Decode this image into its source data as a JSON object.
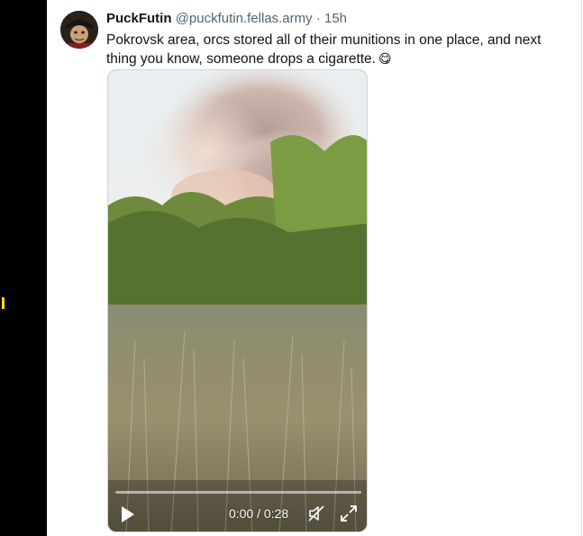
{
  "post": {
    "display_name": "PuckFutin",
    "handle": "@puckfutin.fellas.army",
    "separator": "·",
    "time_ago": "15h",
    "text": "Pokrovsk area, orcs stored all of their munitions in one place, and next thing you know, someone drops a cigarette.",
    "emoji": "😋"
  },
  "video": {
    "time_display": "0:00 / 0:28",
    "progress": 0,
    "controls": {
      "play_icon": "play-icon",
      "mute_icon": "muted-speaker-icon",
      "fullscreen_icon": "fullscreen-icon"
    }
  },
  "colors": {
    "left_bar": "#000000",
    "marker": "#f5e400",
    "text_primary": "#0f1419",
    "text_secondary": "#536471"
  }
}
